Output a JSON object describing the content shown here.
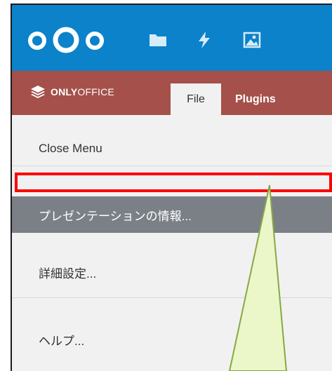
{
  "header": {
    "logo_icon": "nextcloud-logo-icon",
    "nav_icons": [
      "folder-icon",
      "lightning-icon",
      "image-icon"
    ]
  },
  "ribbon": {
    "brand_prefix": "ONLY",
    "brand_suffix": "OFFICE",
    "brand_icon": "onlyoffice-layers-icon",
    "tabs": [
      {
        "label": "File",
        "active": true
      },
      {
        "label": "Plugins",
        "active": false
      }
    ]
  },
  "file_menu": {
    "items": [
      {
        "label": "Close Menu"
      },
      {
        "label": ""
      },
      {
        "label": "プレゼンテーションの情報..."
      },
      {
        "label": "詳細設定..."
      },
      {
        "label": "ヘルプ..."
      }
    ]
  },
  "colors": {
    "topbar": "#0b82c9",
    "ribbon": "#a5504a",
    "selected_item": "#7b8087",
    "highlight_border": "#ff0000",
    "callout_fill": "#ebf6c9",
    "callout_stroke": "#88a845"
  }
}
